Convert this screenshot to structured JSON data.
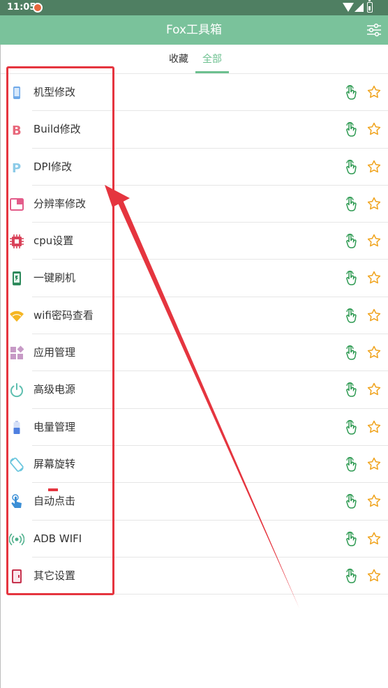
{
  "status_bar": {
    "time": "11:05"
  },
  "app_bar": {
    "title": "Fox工具箱",
    "settings_icon": "sliders-icon"
  },
  "tabs": [
    {
      "label": "收藏",
      "selected": false
    },
    {
      "label": "全部",
      "selected": true
    }
  ],
  "items": [
    {
      "label": "机型修改",
      "icon": "phone-icon"
    },
    {
      "label": "Build修改",
      "icon": "letter-b-icon"
    },
    {
      "label": "DPI修改",
      "icon": "letter-p-icon"
    },
    {
      "label": "分辨率修改",
      "icon": "resolution-icon"
    },
    {
      "label": "cpu设置",
      "icon": "cpu-chip-icon"
    },
    {
      "label": "一键刷机",
      "icon": "flash-phone-icon"
    },
    {
      "label": "wifi密码查看",
      "icon": "wifi-icon"
    },
    {
      "label": "应用管理",
      "icon": "apps-grid-icon"
    },
    {
      "label": "高级电源",
      "icon": "power-icon"
    },
    {
      "label": "电量管理",
      "icon": "battery-icon"
    },
    {
      "label": "屏幕旋转",
      "icon": "screen-rotation-icon"
    },
    {
      "label": "自动点击",
      "icon": "touch-hand-icon"
    },
    {
      "label": "ADB WIFI",
      "icon": "adb-wifi-icon"
    },
    {
      "label": "其它设置",
      "icon": "other-settings-icon"
    }
  ],
  "row_actions": {
    "shortcut_icon": "tap-hand-icon",
    "favorite_icon": "star-outline-icon"
  },
  "colors": {
    "status_bar": "#4f7f62",
    "app_bar": "#7ac29b",
    "accent": "#6cc08f",
    "annotation": "#e5353f",
    "star": "#f0a31c"
  }
}
